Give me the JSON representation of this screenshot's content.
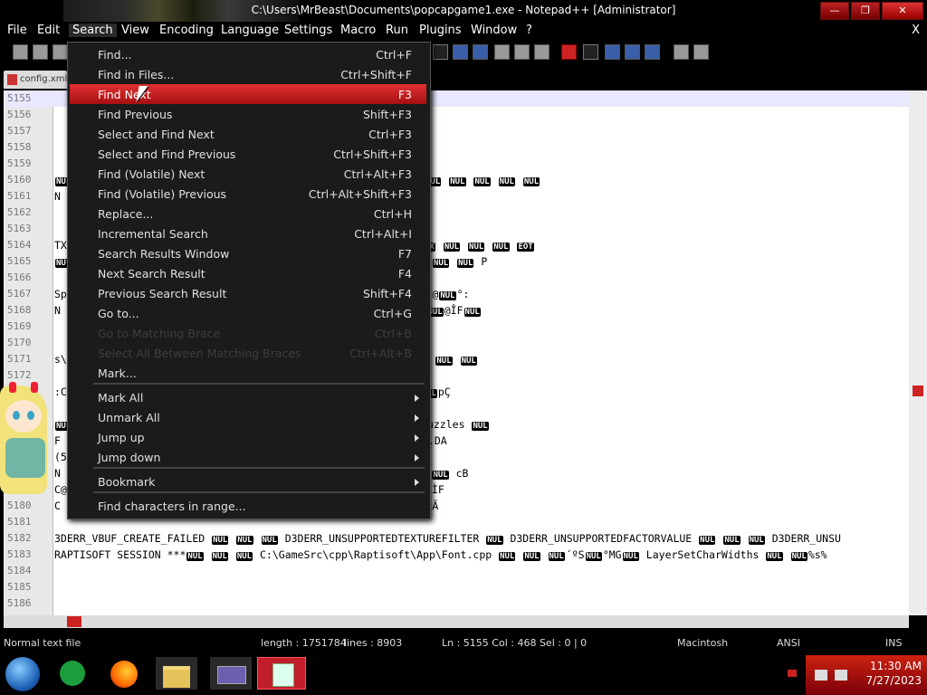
{
  "window": {
    "title": "C:\\Users\\MrBeast\\Documents\\popcapgame1.exe - Notepad++ [Administrator]",
    "buttons": {
      "minimize": "—",
      "maximize": "❐",
      "close": "✕"
    }
  },
  "menubar": [
    "File",
    "Edit",
    "Search",
    "View",
    "Encoding",
    "Language",
    "Settings",
    "Macro",
    "Run",
    "Plugins",
    "Window",
    "?"
  ],
  "menubar_close": "X",
  "tab": {
    "label": "config.xml"
  },
  "search_menu": {
    "items": [
      {
        "label": "Find...",
        "shortcut": "Ctrl+F"
      },
      {
        "label": "Find in Files...",
        "shortcut": "Ctrl+Shift+F"
      },
      {
        "label": "Find Next",
        "shortcut": "F3",
        "highlighted": true
      },
      {
        "label": "Find Previous",
        "shortcut": "Shift+F3"
      },
      {
        "label": "Select and Find Next",
        "shortcut": "Ctrl+F3"
      },
      {
        "label": "Select and Find Previous",
        "shortcut": "Ctrl+Shift+F3"
      },
      {
        "label": "Find (Volatile) Next",
        "shortcut": "Ctrl+Alt+F3"
      },
      {
        "label": "Find (Volatile) Previous",
        "shortcut": "Ctrl+Alt+Shift+F3"
      },
      {
        "label": "Replace...",
        "shortcut": "Ctrl+H"
      },
      {
        "label": "Incremental Search",
        "shortcut": "Ctrl+Alt+I"
      },
      {
        "label": "Search Results Window",
        "shortcut": "F7"
      },
      {
        "label": "Next Search Result",
        "shortcut": "F4"
      },
      {
        "label": "Previous Search Result",
        "shortcut": "Shift+F4"
      },
      {
        "label": "Go to...",
        "shortcut": "Ctrl+G"
      },
      {
        "label": "Go to Matching Brace",
        "shortcut": "Ctrl+B",
        "disabled": true
      },
      {
        "label": "Select All Between Matching Braces",
        "shortcut": "Ctrl+Alt+B",
        "disabled": true
      },
      {
        "label": "Mark...",
        "shortcut": ""
      },
      {
        "label": "Mark All",
        "submenu": true
      },
      {
        "label": "Unmark All",
        "submenu": true
      },
      {
        "label": "Jump up",
        "submenu": true
      },
      {
        "label": "Jump down",
        "submenu": true
      },
      {
        "label": "Bookmark",
        "submenu": true
      },
      {
        "label": "Find characters in range...",
        "shortcut": ""
      }
    ]
  },
  "editor": {
    "lines": [
      {
        "num": "5155",
        "code": ""
      },
      {
        "num": "5156",
        "code": ""
      },
      {
        "num": "5157",
        "code": ""
      },
      {
        "num": "5158",
        "code": ""
      },
      {
        "num": "5159",
        "code": ""
      },
      {
        "num": "5160",
        "code": "NUL NUL NUL NUL NUL NUL NUL NUL NUL NUL NUL NUL NUL NUL NUL NUL NUL NUL NUL NUL"
      },
      {
        "num": "5161",
        "code": "N"
      },
      {
        "num": "5162",
        "code": ""
      },
      {
        "num": "5163",
        "code": ""
      },
      {
        "num": "5164",
        "code": "TX  NUL NUL NUL@NUL NUL NUL€NUL NUL NUL NUL SOH NUL NUL NUL STX NUL NUL NUL EOT"
      },
      {
        "num": "5165",
        "code": "   NUL  ÁNUL NUL NUL NUL NUL NUL NUL NUL NUL NUL à?Animator_Hint NUL NUL P"
      },
      {
        "num": "5166",
        "code": ""
      },
      {
        "num": "5167",
        "code": "Sp NUL°:@NULÀ:@NUL`?@NULà?ENULĐ:@NULà:@NUL0šSNULÀ @NULð@NUL ¡@NUL°:"
      },
      {
        "num": "5168",
        "code": " N NULpú@NULpÇFNUL0ÉFNUL DLE ÈFNULàÊFNUL`ÈFNULÐÆFNUL ÇFNUL ÎFNUL@ÎFNUL"
      },
      {
        "num": "5169",
        "code": ""
      },
      {
        "num": "5170",
        "code": ""
      },
      {
        "num": "5171",
        "code": "s\\speaks\\popshriek3 NUL NUL NUL sounds\\speaks\\popshriek2 NUL NUL NUL"
      },
      {
        "num": "5172",
        "code": ""
      },
      {
        "num": "5173",
        "code": ":CNUL°:@NULÀ:@NUL€SUB CNULà?ENULĐ:@NULà:@NUL ÆFNULÀÑFNUL€úBNULpÇ"
      },
      {
        "num": "5174",
        "code": ""
      },
      {
        "num": "5175",
        "code": "NUL NUL>NUL NULÀ>Textures\\zenlight NUL NUL NUL sounds\\boilchuzzles NUL"
      },
      {
        "num": "5176",
        "code": "F  è@NUL NUL»CNULĐĐFNUL Final Score NUL\\SAVEGAME-SPEEDCHUZZLE.DA"
      },
      {
        "num": "5177",
        "code": "(50);             SetCursorShape(1);              PlayPop."
      },
      {
        "num": "5178",
        "code": "N NULÀÌÌà?NUL NUL NUL NUL |@NUL NUL NUL NUL v@NUL NUL 4B NUL NUL cB"
      },
      {
        "num": "5179",
        "code": " C@NUL è@NULÈÄNULÈÄNUL ÈÄNUL°è@NULÈFNULÈFNUL ÈFNULÌFNUL°ÈFNULÈÌF"
      },
      {
        "num": "5180",
        "code": " C ÇFNUL ÎFNUL@ÎFNULPÈFNULpè@NUL`ÈÄNULpÈÄNUL€è@NULè@NUL è@NULÈÄ"
      },
      {
        "num": "5181",
        "code": ""
      },
      {
        "num": "5182",
        "code": "3DERR_VBUF_CREATE_FAILED NUL NUL NUL D3DERR_UNSUPPORTEDTEXTUREFILTER NUL D3DERR_UNSUPPORTEDFACTORVALUE NUL NUL NUL D3DERR_UNSU"
      },
      {
        "num": "5183",
        "code": "RAPTISOFT SESSION ***NUL NUL NUL C:\\GameSrc\\cpp\\Raptisoft\\App\\Font.cpp NUL NUL NUL´ºSNUL°MGNUL LayerSetCharWidths NUL NUL%s%"
      },
      {
        "num": "5184",
        "code": ""
      },
      {
        "num": "5185",
        "code": ""
      },
      {
        "num": "5186",
        "code": ""
      }
    ]
  },
  "statusbar": {
    "filetype": "Normal text file",
    "length": "length : 1751784",
    "lines": "lines : 8903",
    "pos": "Ln : 5155   Col : 468   Sel : 0 | 0",
    "eol": "Macintosh",
    "encoding": "ANSI",
    "mode": "INS"
  },
  "taskbar": {
    "time": "11:30 AM",
    "date": "7/27/2023"
  },
  "colors": {
    "accent": "#c21d2b",
    "highlight": "#d42a2a",
    "menu_bg": "#1b1b1b"
  }
}
